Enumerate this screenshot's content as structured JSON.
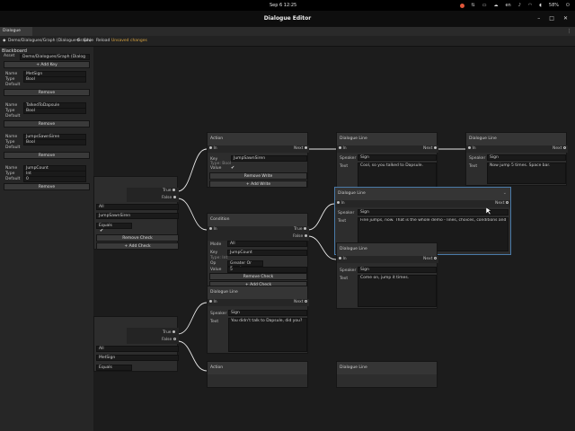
{
  "system_bar": {
    "clock": "Sep 6  12:25",
    "lang": "en",
    "battery": "58%"
  },
  "window": {
    "title": "Dialogue Editor"
  },
  "menu": {
    "tab": "Dialogue Editor"
  },
  "toolbar": {
    "asset_path": "Demo/Dialogues/Graph (Dialogue Graph)",
    "save": "Save",
    "reload": "Reload",
    "unsaved": "Unsaved changes"
  },
  "blackboard": {
    "title": "Blackboard",
    "asset_label": "Asset",
    "asset_value": "Demo/Dialogues/Graph (Dialog",
    "add_key": "+ Add Key",
    "name_label": "Name",
    "type_label": "Type",
    "default_label": "Default",
    "remove": "Remove",
    "keys": [
      {
        "name": "MetSign",
        "type": "Bool",
        "default": ""
      },
      {
        "name": "TalkedToDapsule",
        "type": "Bool",
        "default": ""
      },
      {
        "name": "JumpsSawnSiren",
        "type": "Bool",
        "default": ""
      },
      {
        "name": "JumpCount",
        "type": "Int",
        "default": "0"
      }
    ]
  },
  "nodes": {
    "action1": {
      "title": "Action",
      "in": "In",
      "next": "Next",
      "key_label": "Key",
      "key_value": "JumpSawnSiren",
      "type_label": "Type: Bool",
      "value_label": "Value",
      "value_check": "✔",
      "remove_write": "Remove Write",
      "add_write": "+ Add Write"
    },
    "line1": {
      "title": "Dialogue Line",
      "in": "In",
      "next": "Next",
      "speaker_label": "Speaker",
      "speaker": "Sign",
      "text_label": "Text",
      "text": "Cool, so you talked to Dapsule."
    },
    "line2": {
      "title": "Dialogue Line",
      "in": "In",
      "next": "Next",
      "speaker_label": "Speaker",
      "speaker": "Sign",
      "text_label": "Text",
      "text": "Now jump 5 times. Space bar."
    },
    "line3": {
      "title": "Dialogue Line",
      "in": "In",
      "next": "Next",
      "speaker_label": "Speaker",
      "speaker": "Sign",
      "text_label": "Text",
      "text": "Fine jumps, now. That is the whole demo - lines, choices, conditions and blackboard values."
    },
    "line4": {
      "title": "Dialogue Line",
      "in": "In",
      "next": "Next",
      "speaker_label": "Speaker",
      "speaker": "Sign",
      "text_label": "Text",
      "text": "Come on, jump it times."
    },
    "condition1": {
      "title": "Condition",
      "in": "In",
      "true": "True",
      "false": "False",
      "mode_label": "Mode",
      "mode": "All",
      "key_label": "Key",
      "key": "JumpCount",
      "type_label": "Type: Int",
      "op_label": "Op",
      "op": "Greater Or Equals",
      "value_label": "Value",
      "value": "5",
      "remove_check": "Remove Check",
      "add_check": "+ Add Check"
    },
    "cond_left1": {
      "true": "True",
      "false": "False",
      "mode": "All",
      "key": "JumpSawnSiren",
      "op": "Equals",
      "check": "✔",
      "remove_check": "Remove Check",
      "add_check": "+ Add Check"
    },
    "line5": {
      "title": "Dialogue Line",
      "in": "In",
      "next": "Next",
      "speaker_label": "Speaker",
      "speaker": "Sign",
      "text_label": "Text",
      "text": "You didn't talk to Dapsule, did you?"
    },
    "cond_left2": {
      "true": "True",
      "false": "False",
      "mode": "All",
      "key": "MetSign",
      "op": "Equals"
    },
    "action2": {
      "title": "Action"
    },
    "line6": {
      "title": "Dialogue Line"
    }
  }
}
